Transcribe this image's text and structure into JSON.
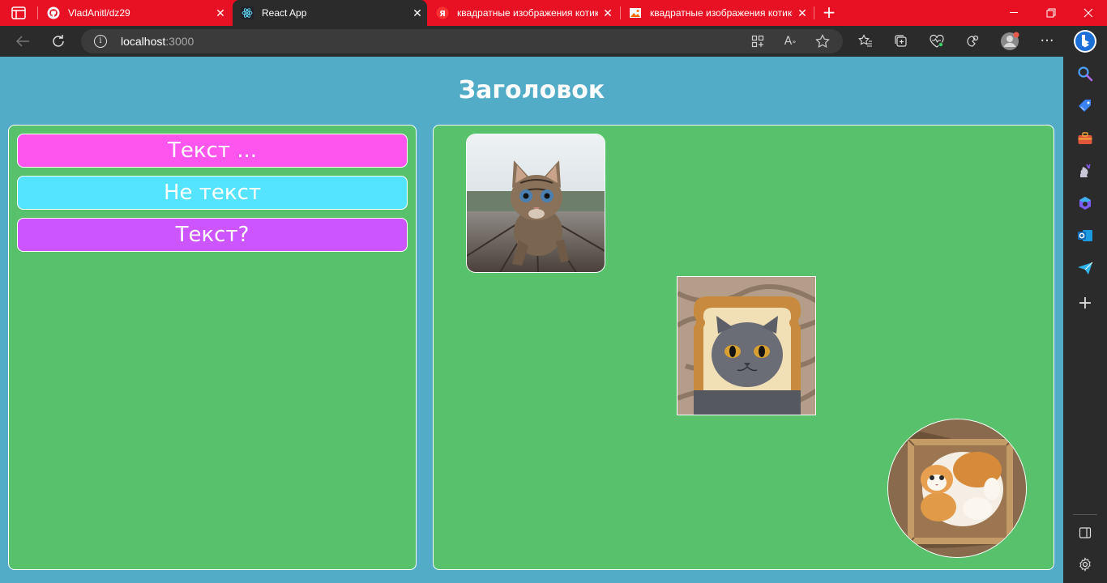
{
  "browser": {
    "tabs": [
      {
        "label": "VladAnitl/dz29",
        "icon": "github-icon",
        "active": false
      },
      {
        "label": "React App",
        "icon": "react-icon",
        "active": true
      },
      {
        "label": "квадратные изображения котиков",
        "icon": "yandex-icon",
        "active": false
      },
      {
        "label": "квадратные изображения котиков",
        "icon": "image-icon",
        "active": false
      }
    ],
    "address": {
      "host": "localhost",
      "port": ":3000"
    }
  },
  "page": {
    "heading": "Заголовок",
    "buttons": [
      {
        "label": "Текст ...",
        "color": "#ff55ef"
      },
      {
        "label": "Не текст",
        "color": "#55e4ff"
      },
      {
        "label": "Текст?",
        "color": "#cc55ff"
      }
    ],
    "images": [
      {
        "subject": "tabby kitten on wooden planks",
        "shape": "rounded-square"
      },
      {
        "subject": "grey cat with face in toast slice",
        "shape": "square"
      },
      {
        "subject": "fluffy cat lying in cardboard box",
        "shape": "circle"
      }
    ]
  },
  "colors": {
    "tabbar": "#e81123",
    "toolbar": "#2b2b2b",
    "page_background": "#52acc8",
    "panel_background": "#58c16c"
  }
}
